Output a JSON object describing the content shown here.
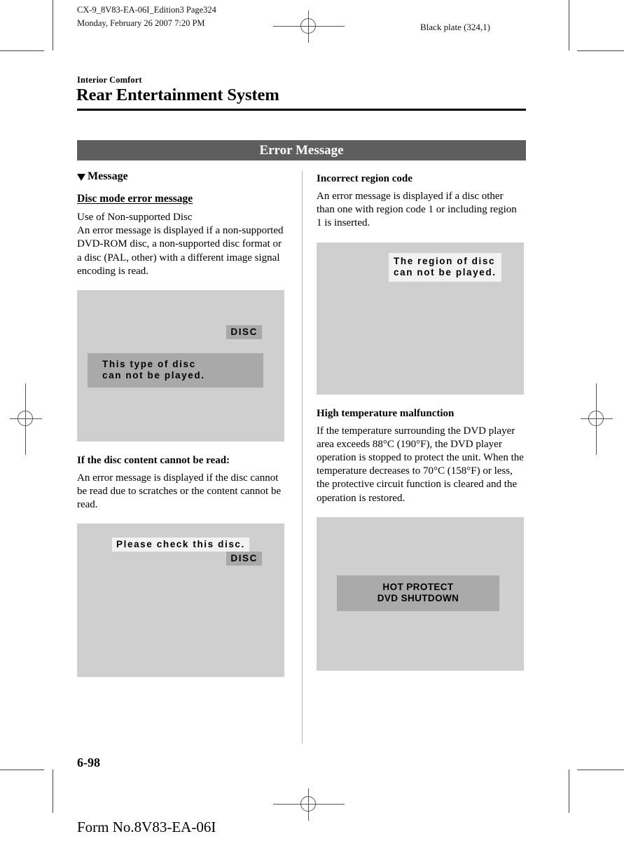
{
  "print_marks": {
    "header_line1": "CX-9_8V83-EA-06I_Edition3 Page324",
    "header_line2": "Monday, February 26 2007 7:20 PM",
    "black_plate": "Black plate (324,1)"
  },
  "title": {
    "kicker": "Interior Comfort",
    "heading": "Rear Entertainment System"
  },
  "banner": {
    "label": "Error Message"
  },
  "left_column": {
    "message_heading": "Message",
    "disc_mode_heading": "Disc mode error message",
    "disc_mode_body": "Use of Non-supported Disc\nAn error message is displayed if a non-supported DVD-ROM disc, a non-supported disc format or a disc (PAL, other) with a different image signal encoding is read.",
    "figure1": {
      "badge": "DISC",
      "message": "This type of disc\ncan not be played."
    },
    "cannot_read_heading": "If the disc content cannot be read:",
    "cannot_read_body": "An error message is displayed if the disc cannot be read due to scratches or the content cannot be read.",
    "figure2": {
      "message": "Please check this disc.",
      "badge": "DISC"
    }
  },
  "right_column": {
    "region_heading": "Incorrect region code",
    "region_body": "An error message is displayed if a disc other than one with region code 1 or including region 1 is inserted.",
    "figure3": {
      "message": "The region of disc\ncan not be played."
    },
    "temp_heading": "High temperature malfunction",
    "temp_body": "If the temperature surrounding the DVD player area exceeds 88°C (190°F), the DVD player operation is stopped to protect the unit. When the temperature decreases to 70°C (158°F) or less, the protective circuit function is cleared and the operation is restored.",
    "figure4": {
      "message": "HOT  PROTECT\nDVD  SHUTDOWN"
    }
  },
  "footer": {
    "page_number": "6-98",
    "form_number": "Form No.8V83-EA-06I"
  },
  "colors": {
    "banner_bg": "#5e5e5e",
    "screen_bg": "#cfcfcf",
    "osd_gray": "#a9a9a9",
    "osd_white": "#f2f2f2"
  }
}
